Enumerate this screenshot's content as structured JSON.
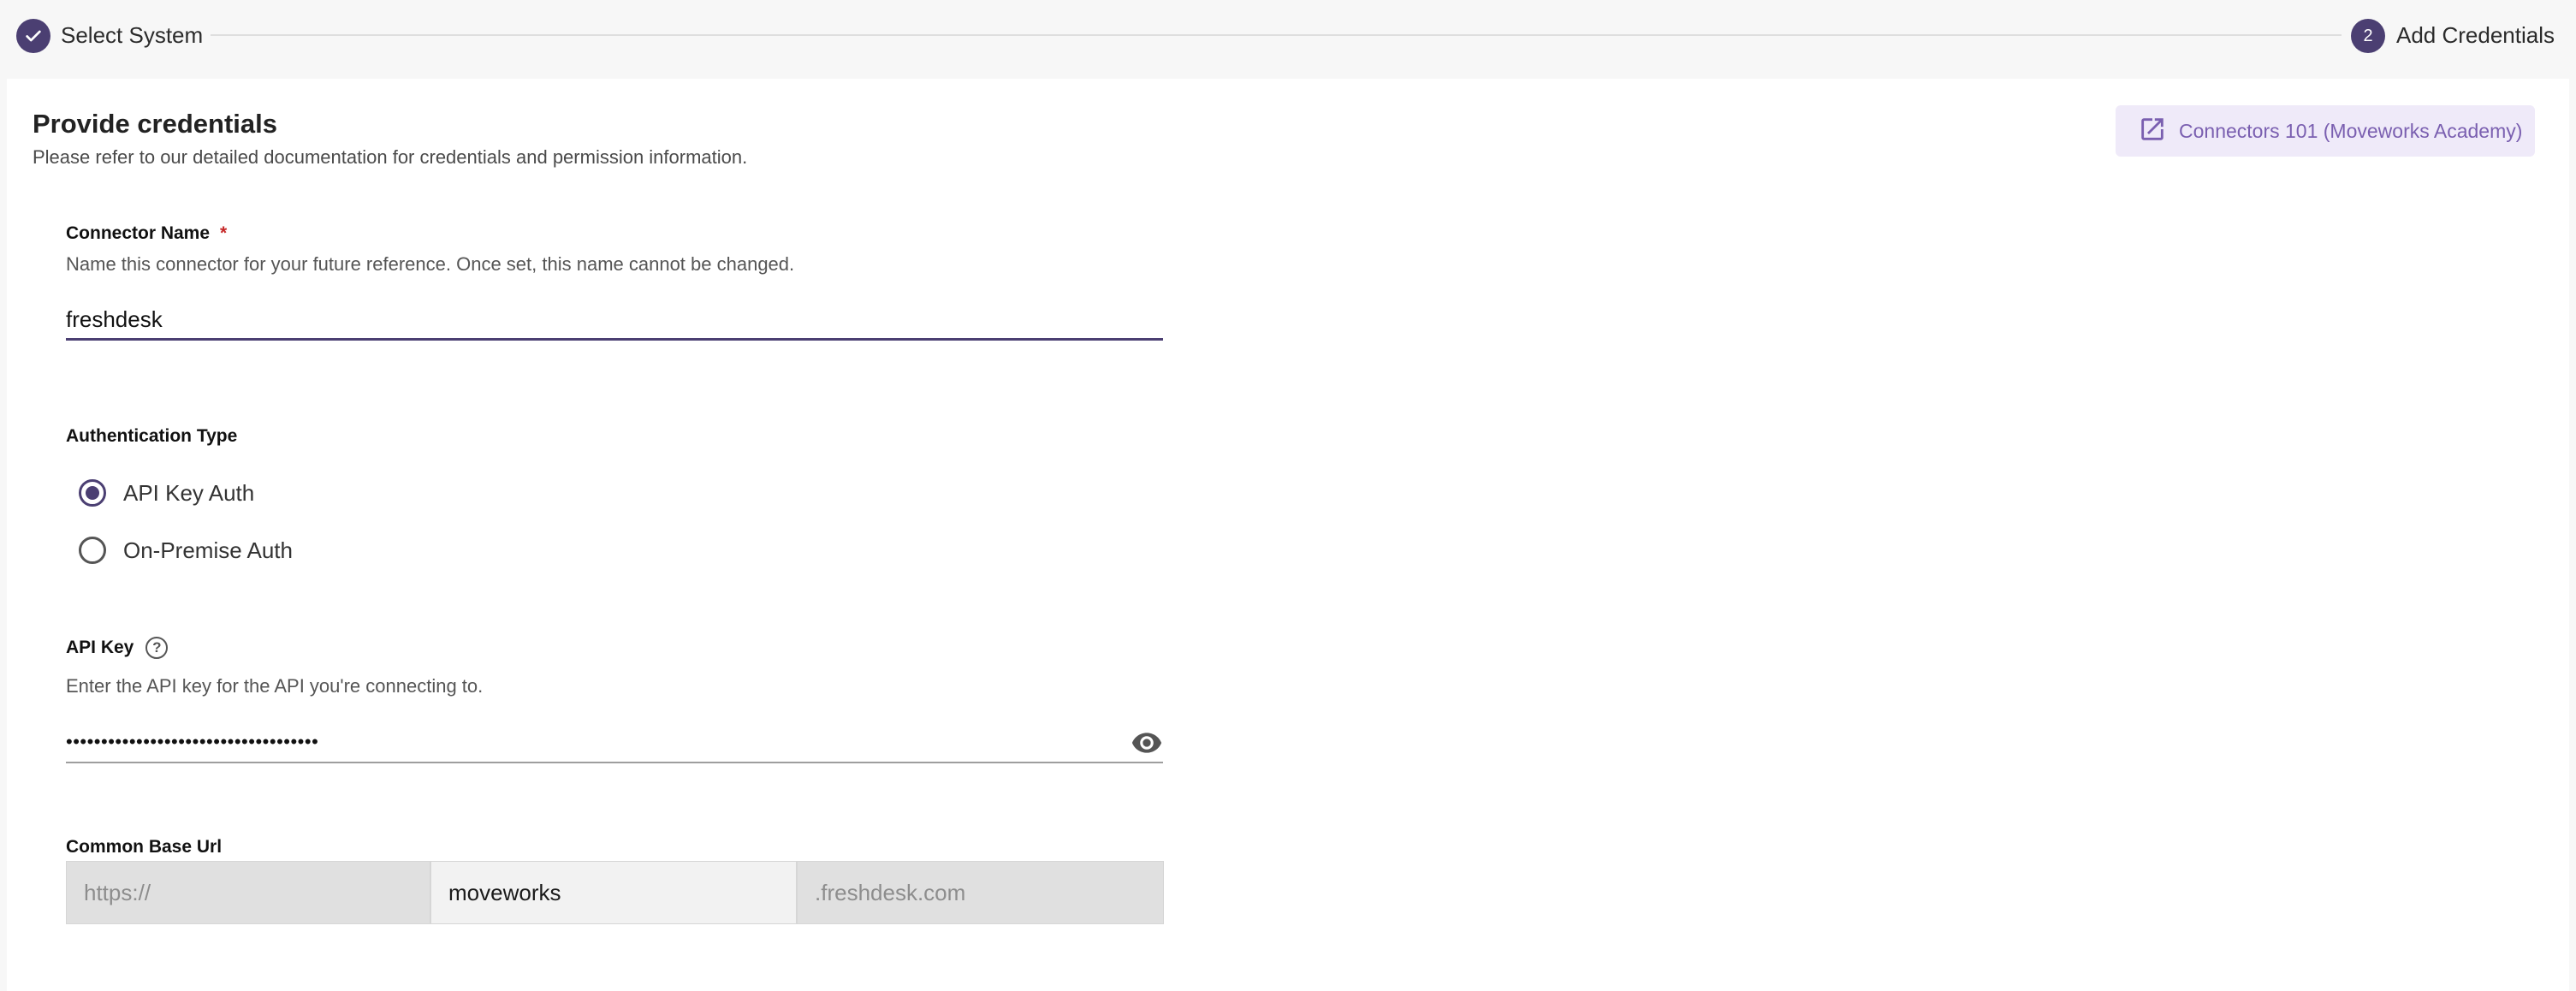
{
  "stepper": {
    "step1_label": "Select System",
    "step2_number": "2",
    "step2_label": "Add Credentials"
  },
  "header": {
    "title": "Provide credentials",
    "subtitle": "Please refer to our detailed documentation for credentials and permission information.",
    "academy_link": "Connectors 101 (Moveworks Academy)"
  },
  "connector_name": {
    "label": "Connector Name",
    "required_mark": "*",
    "help": "Name this connector for your future reference. Once set, this name cannot be changed.",
    "value": "freshdesk"
  },
  "auth_type": {
    "label": "Authentication Type",
    "options": [
      {
        "label": "API Key Auth",
        "selected": true
      },
      {
        "label": "On-Premise Auth",
        "selected": false
      }
    ]
  },
  "api_key": {
    "label": "API Key",
    "help_icon": "?",
    "help": "Enter the API key for the API you're connecting to.",
    "masked_value": "••••••••••••••••••••••••••••••••••••"
  },
  "base_url": {
    "label": "Common Base Url",
    "prefix": "https://",
    "value": "moveworks",
    "suffix": ".freshdesk.com"
  },
  "colors": {
    "accent": "#4b3f72",
    "link": "#7a5fb0",
    "required": "#c62828"
  }
}
